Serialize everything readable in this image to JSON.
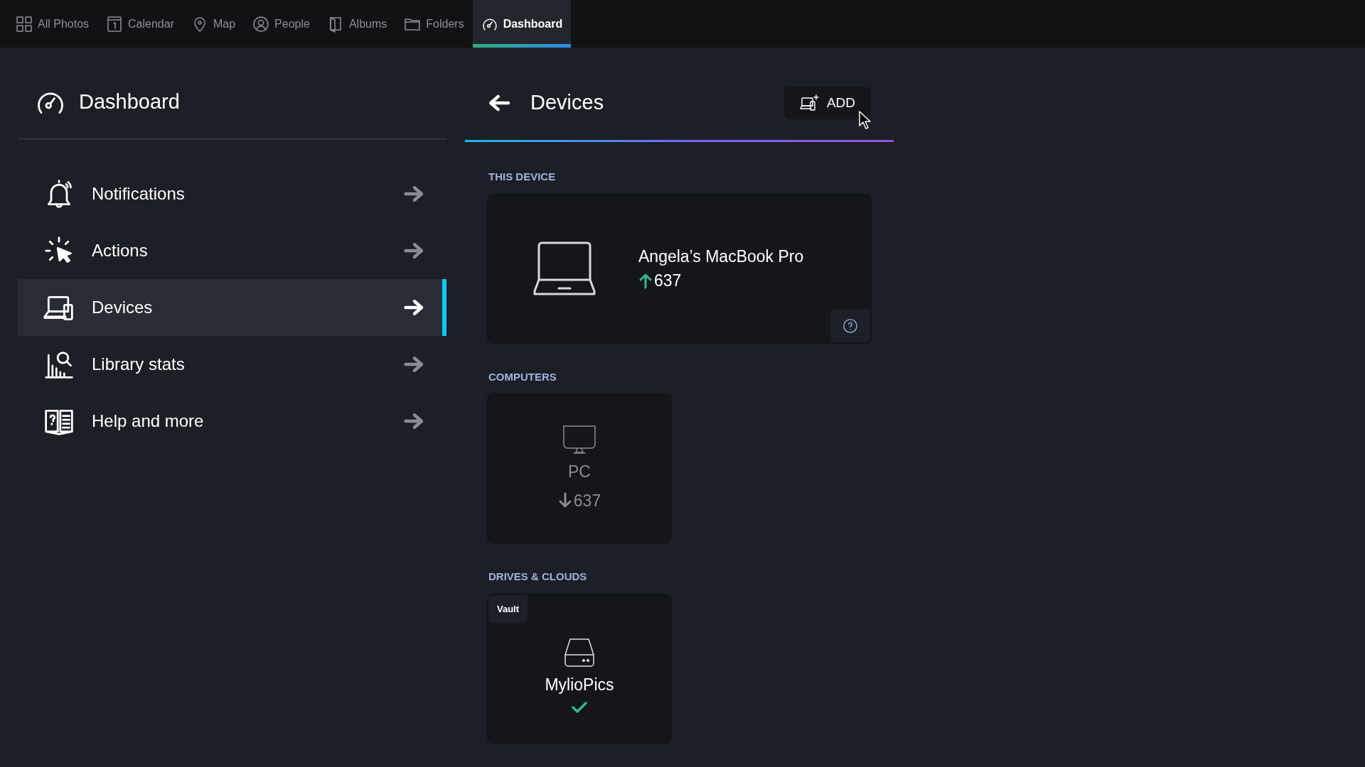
{
  "tabs": [
    {
      "label": "All Photos",
      "selected": false
    },
    {
      "label": "Calendar",
      "selected": false
    },
    {
      "label": "Map",
      "selected": false
    },
    {
      "label": "People",
      "selected": false
    },
    {
      "label": "Albums",
      "selected": false
    },
    {
      "label": "Folders",
      "selected": false
    },
    {
      "label": "Dashboard",
      "selected": true
    }
  ],
  "sidebar": {
    "title": "Dashboard",
    "items": [
      {
        "label": "Notifications",
        "selected": false
      },
      {
        "label": "Actions",
        "selected": false
      },
      {
        "label": "Devices",
        "selected": true
      },
      {
        "label": "Library stats",
        "selected": false
      },
      {
        "label": "Help and more",
        "selected": false
      }
    ]
  },
  "devices_panel": {
    "title": "Devices",
    "add_button": "ADD",
    "this_device": {
      "heading": "THIS DEVICE",
      "name": "Angela’s MacBook Pro",
      "count": "637",
      "upload": true
    },
    "computers": {
      "heading": "COMPUTERS",
      "items": [
        {
          "name": "PC",
          "count": "637",
          "upload": false,
          "online": false
        }
      ]
    },
    "drives": {
      "heading": "DRIVES & CLOUDS",
      "items": [
        {
          "badge": "Vault",
          "name": "MylioPics",
          "synced": true
        }
      ]
    }
  }
}
